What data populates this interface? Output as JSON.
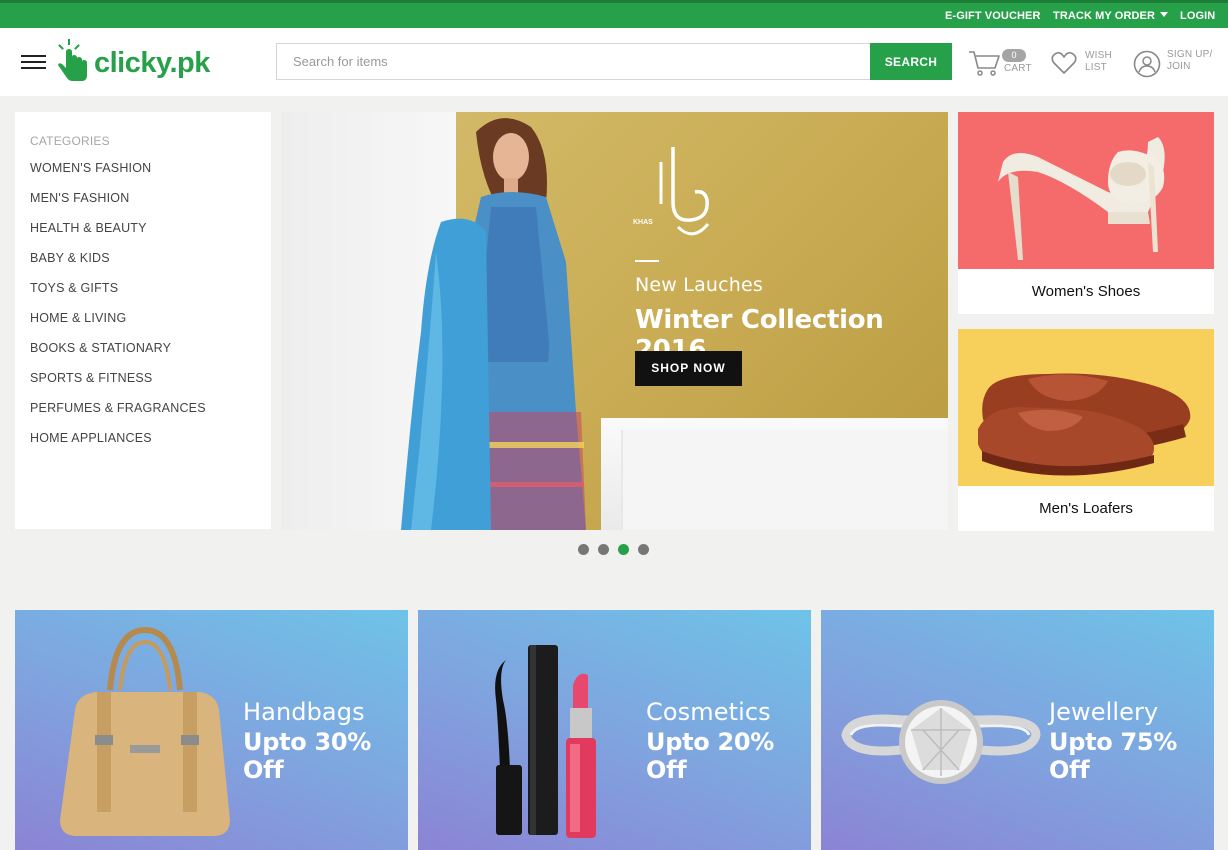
{
  "topbar": {
    "gift_voucher": "E-GIFT VOUCHER",
    "track_order": "TRACK MY ORDER",
    "login": "LOGIN",
    "color": "#27a04a"
  },
  "header": {
    "logo_text": "clicky.pk",
    "search_placeholder": "Search for items",
    "search_value": "",
    "search_button": "SEARCH",
    "cart_count": "0",
    "cart_label": "CART",
    "wish_line1": "WISH",
    "wish_line2": "LIST",
    "signup_line1": "SIGN UP/",
    "signup_line2": "JOIN",
    "icons": [
      "menu-icon",
      "hand-pointer-logo-icon",
      "cart-icon",
      "heart-icon",
      "user-icon"
    ]
  },
  "categories": {
    "title": "CATEGORIES",
    "items": [
      "WOMEN'S FASHION",
      "MEN'S FASHION",
      "HEALTH & BEAUTY",
      "BABY & KIDS",
      "TOYS & GIFTS",
      "HOME & LIVING",
      "BOOKS & STATIONARY",
      "SPORTS & FITNESS",
      "PERFUMES & FRAGRANCES",
      "HOME APPLIANCES"
    ]
  },
  "hero": {
    "brand": "KHAS",
    "subtitle": "New Lauches",
    "title": "Winter Collection 2016",
    "button": "SHOP NOW",
    "slides": 4,
    "active_slide": 3
  },
  "side_promos": [
    {
      "caption": "Women's Shoes",
      "bg": "#f56a6a"
    },
    {
      "caption": "Men's Loafers",
      "bg": "#f7cf5b"
    }
  ],
  "promos": [
    {
      "name": "Handbags",
      "offer": "Upto 30% Off"
    },
    {
      "name": "Cosmetics",
      "offer": "Upto 20% Off"
    },
    {
      "name": "Jewellery",
      "offer": "Upto 75% Off"
    }
  ]
}
